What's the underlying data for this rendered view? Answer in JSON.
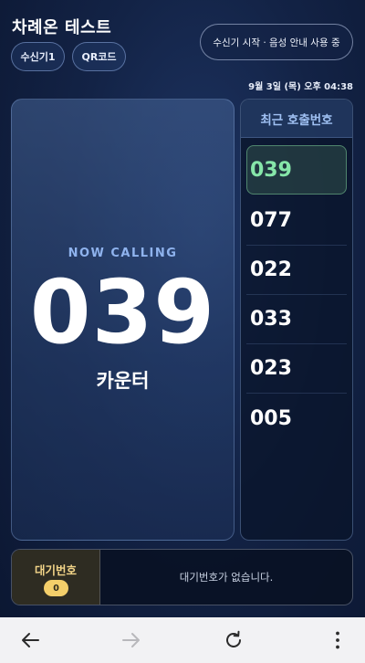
{
  "app": {
    "title": "차례온 테스트",
    "receiver_button": "수신기1",
    "qr_button": "QR코드",
    "status_button": "수신기 시작 · 음성 안내 사용 중",
    "datetime": "9월 3일 (목) 오후 04:38"
  },
  "now_calling": {
    "label": "NOW CALLING",
    "number": "039",
    "counter": "카운터"
  },
  "recent": {
    "header": "최근 호출번호",
    "items": [
      "039",
      "077",
      "022",
      "033",
      "023",
      "005"
    ]
  },
  "waiting": {
    "label": "대기번호",
    "count": "0",
    "empty_message": "대기번호가 없습니다."
  },
  "browser_nav": {
    "icons": [
      "back-arrow-icon",
      "forward-arrow-icon",
      "reload-icon",
      "more-vert-icon"
    ]
  },
  "colors": {
    "accent_blue": "#8fb3ee",
    "current_green": "#86e6a9",
    "badge_yellow": "#f4cf6a"
  }
}
